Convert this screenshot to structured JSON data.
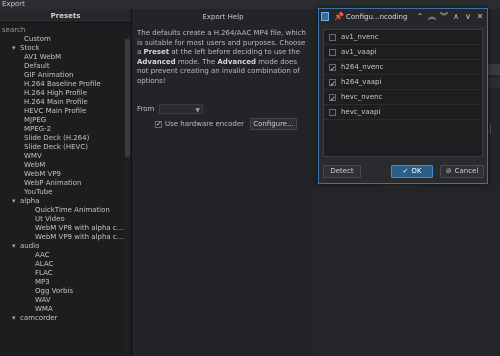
{
  "window": {
    "title": "Export"
  },
  "presets": {
    "header": "Presets",
    "search_placeholder": "search",
    "rows": [
      {
        "label": "Custom",
        "depth": 1,
        "arrow": ""
      },
      {
        "label": "Stock",
        "depth": 0,
        "arrow": "▾"
      },
      {
        "label": "AV1 WebM",
        "depth": 1,
        "arrow": ""
      },
      {
        "label": "Default",
        "depth": 1,
        "arrow": ""
      },
      {
        "label": "GIF Animation",
        "depth": 1,
        "arrow": ""
      },
      {
        "label": "H.264 Baseline Profile",
        "depth": 1,
        "arrow": ""
      },
      {
        "label": "H.264 High Profile",
        "depth": 1,
        "arrow": ""
      },
      {
        "label": "H.264 Main Profile",
        "depth": 1,
        "arrow": ""
      },
      {
        "label": "HEVC Main Profile",
        "depth": 1,
        "arrow": ""
      },
      {
        "label": "MJPEG",
        "depth": 1,
        "arrow": ""
      },
      {
        "label": "MPEG-2",
        "depth": 1,
        "arrow": ""
      },
      {
        "label": "Slide Deck (H.264)",
        "depth": 1,
        "arrow": ""
      },
      {
        "label": "Slide Deck (HEVC)",
        "depth": 1,
        "arrow": ""
      },
      {
        "label": "WMV",
        "depth": 1,
        "arrow": ""
      },
      {
        "label": "WebM",
        "depth": 1,
        "arrow": ""
      },
      {
        "label": "WebM VP9",
        "depth": 1,
        "arrow": ""
      },
      {
        "label": "WebP Animation",
        "depth": 1,
        "arrow": ""
      },
      {
        "label": "YouTube",
        "depth": 1,
        "arrow": ""
      },
      {
        "label": "alpha",
        "depth": 0,
        "arrow": "▾"
      },
      {
        "label": "QuickTime Animation",
        "depth": 2,
        "arrow": ""
      },
      {
        "label": "Ut Video",
        "depth": 2,
        "arrow": ""
      },
      {
        "label": "WebM VP8 with alpha c...",
        "depth": 2,
        "arrow": ""
      },
      {
        "label": "WebM VP9 with alpha c...",
        "depth": 2,
        "arrow": ""
      },
      {
        "label": "audio",
        "depth": 0,
        "arrow": "▾"
      },
      {
        "label": "AAC",
        "depth": 2,
        "arrow": ""
      },
      {
        "label": "ALAC",
        "depth": 2,
        "arrow": ""
      },
      {
        "label": "FLAC",
        "depth": 2,
        "arrow": ""
      },
      {
        "label": "MP3",
        "depth": 2,
        "arrow": ""
      },
      {
        "label": "Ogg Vorbis",
        "depth": 2,
        "arrow": ""
      },
      {
        "label": "WAV",
        "depth": 2,
        "arrow": ""
      },
      {
        "label": "WMA",
        "depth": 2,
        "arrow": ""
      },
      {
        "label": "camcorder",
        "depth": 0,
        "arrow": "▾"
      }
    ]
  },
  "help": {
    "title": "Export Help",
    "text_1": "The defaults create a H.264/AAC MP4 file, which is suitable for most users and purposes. Choose a ",
    "bold_1": "Preset",
    "text_2": " at the left before deciding to use the ",
    "bold_2": "Advanced",
    "text_3": " mode. The ",
    "bold_3": "Advanced",
    "text_4": " mode does not prevent creating an invalid combination of options!",
    "from_label": "From",
    "from_value": "",
    "hw_label": "Use hardware encoder",
    "hw_checked": true,
    "configure_label": "Configure..."
  },
  "dialog": {
    "title": "Configu...ncoding",
    "icons": [
      "pin-icon",
      "restore-icon",
      "up-double-icon",
      "down-double-icon",
      "up-icon",
      "down-icon",
      "close-icon"
    ],
    "items": [
      {
        "label": "av1_nvenc",
        "checked": false
      },
      {
        "label": "av1_vaapi",
        "checked": false
      },
      {
        "label": "h264_nvenc",
        "checked": true
      },
      {
        "label": "h264_vaapi",
        "checked": true
      },
      {
        "label": "hevc_nvenc",
        "checked": true
      },
      {
        "label": "hevc_vaapi",
        "checked": false
      }
    ],
    "detect_label": "Detect",
    "ok_label": "OK",
    "cancel_label": "Cancel"
  },
  "colors": {
    "accent": "#3a73a8",
    "ok_button": "#2c5e8c",
    "background": "#232427"
  }
}
